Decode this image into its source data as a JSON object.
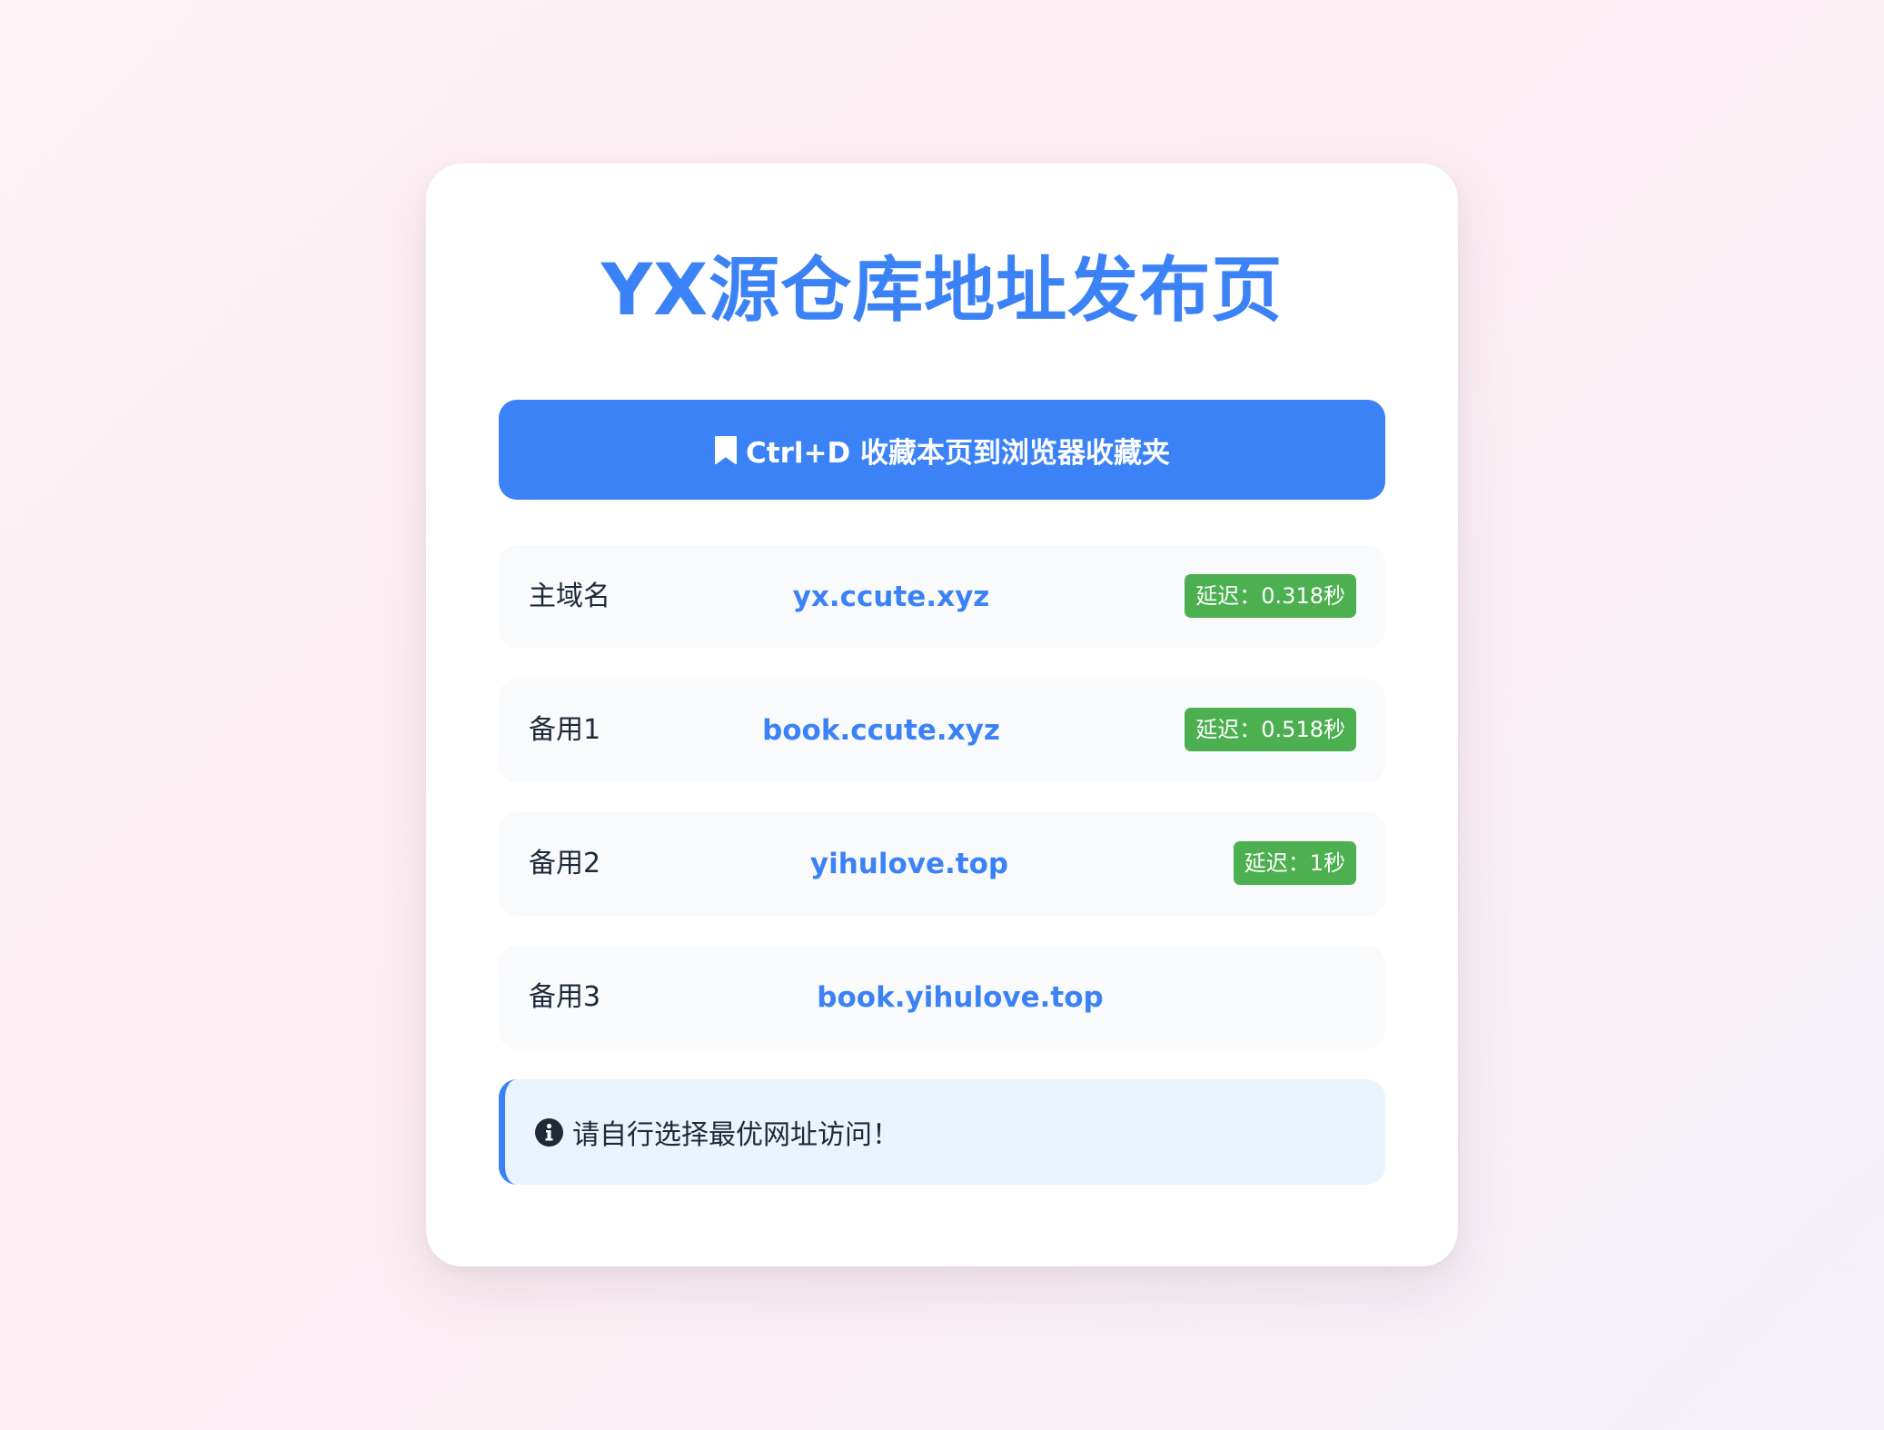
{
  "page": {
    "title": "YX源仓库地址发布页"
  },
  "bookmark": {
    "icon": "bookmark-icon",
    "label": "Ctrl+D 收藏本页到浏览器收藏夹"
  },
  "domains": [
    {
      "label": "主域名",
      "url": "yx.ccute.xyz",
      "latency": "延迟：0.318秒"
    },
    {
      "label": "备用1",
      "url": "book.ccute.xyz",
      "latency": "延迟：0.518秒"
    },
    {
      "label": "备用2",
      "url": "yihulove.top",
      "latency": "延迟：1秒"
    },
    {
      "label": "备用3",
      "url": "book.yihulove.top"
    }
  ],
  "notice": {
    "icon": "info-icon",
    "text": "请自行选择最优网址访问！"
  },
  "colors": {
    "accent": "#3b82f6",
    "latency_badge": "#4caf50",
    "notice_bg": "#eaf4ff"
  }
}
